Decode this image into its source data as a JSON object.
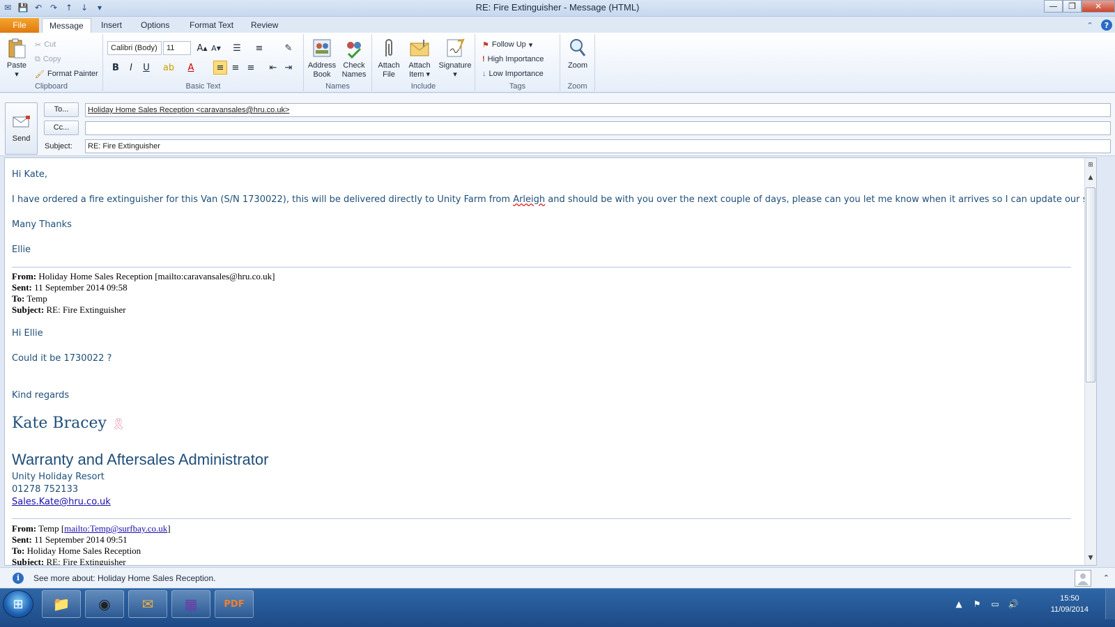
{
  "window": {
    "title": "RE: Fire Extinguisher - Message (HTML)"
  },
  "tabs": [
    "File",
    "Message",
    "Insert",
    "Options",
    "Format Text",
    "Review"
  ],
  "ribbon": {
    "clipboard": {
      "label": "Clipboard",
      "paste": "Paste",
      "cut": "Cut",
      "copy": "Copy",
      "format_painter": "Format Painter"
    },
    "basic_text": {
      "label": "Basic Text",
      "font_name": "Calibri (Body)",
      "font_size": "11"
    },
    "names": {
      "label": "Names",
      "address_book_1": "Address",
      "address_book_2": "Book",
      "check_names_1": "Check",
      "check_names_2": "Names"
    },
    "include": {
      "label": "Include",
      "attach_file_1": "Attach",
      "attach_file_2": "File",
      "attach_item_1": "Attach",
      "attach_item_2": "Item",
      "signature": "Signature"
    },
    "tags": {
      "label": "Tags",
      "follow_up": "Follow Up",
      "high_importance": "High Importance",
      "low_importance": "Low Importance"
    },
    "zoom": {
      "label": "Zoom",
      "zoom": "Zoom"
    }
  },
  "header": {
    "send": "Send",
    "to_button": "To...",
    "cc_button": "Cc...",
    "subject_label": "Subject:",
    "to_value": "Holiday Home Sales Reception <caravansales@hru.co.uk>",
    "cc_value": "",
    "subject_value": "RE: Fire Extinguisher"
  },
  "body": {
    "greeting": "Hi Kate,",
    "para1_a": "I have ordered a fire extinguisher for this Van (S/N 1730022), this will be delivered directly to Unity Farm from ",
    "para1_b": "Arleigh",
    "para1_c": " and should be with you over the next couple of days, please can you let me know when it arrives so I can update our system.",
    "thanks": "Many Thanks",
    "signoff": "Ellie",
    "quote1": {
      "from_label": "From:",
      "from_value": " Holiday Home Sales Reception [mailto:caravansales@hru.co.uk]",
      "sent_label": "Sent:",
      "sent_value": " 11 September 2014 09:58",
      "to_label": "To:",
      "to_value": " Temp",
      "subject_label": "Subject:",
      "subject_value": " RE: Fire Extinguisher",
      "greeting": "Hi Ellie",
      "line": "Could it be 1730022 ?",
      "regards": "Kind regards",
      "sig_name": "Kate Bracey",
      "sig_title": "Warranty and Aftersales Administrator",
      "sig_company": "Unity Holiday Resort",
      "sig_phone": "01278 752133",
      "sig_email": "Sales.Kate@hru.co.uk"
    },
    "quote2": {
      "from_label": "From:",
      "from_value_a": " Temp [",
      "from_link": "mailto:Temp@surfbay.co.uk",
      "from_value_b": "]",
      "sent_label": "Sent:",
      "sent_value": " 11 September 2014 09:51",
      "to_label": "To:",
      "to_value": " Holiday Home Sales Reception",
      "subject_label": "Subject:",
      "subject_value": " RE: Fire Extinguisher"
    }
  },
  "people_pane": {
    "text": "See more about: Holiday Home Sales Reception."
  },
  "taskbar": {
    "time": "15:50",
    "date": "11/09/2014"
  },
  "colors": {
    "accent": "#2a6bc4",
    "file_tab": "#e88a18",
    "body_text": "#1f4e79"
  }
}
